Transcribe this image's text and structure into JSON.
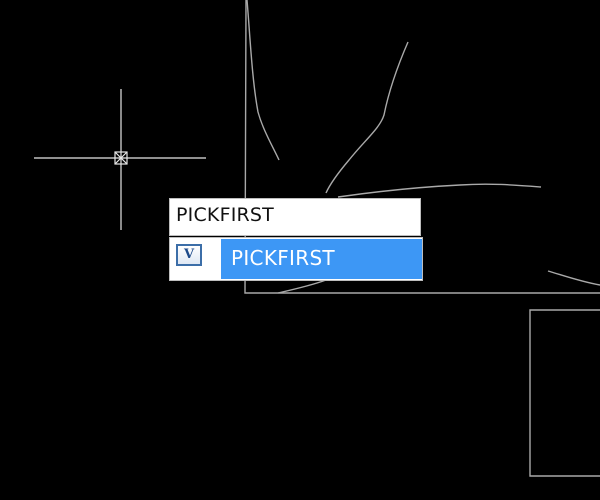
{
  "command_line": {
    "input_value": "PICKFIRST"
  },
  "autocomplete": {
    "items": [
      {
        "label": "PICKFIRST",
        "icon": "system-variable-icon",
        "icon_glyph": "V",
        "selected": true
      }
    ]
  },
  "colors": {
    "background": "#000000",
    "geometry": "#a9a9a9",
    "crosshair": "#e6e6e6",
    "selection": "#3d97f5"
  }
}
